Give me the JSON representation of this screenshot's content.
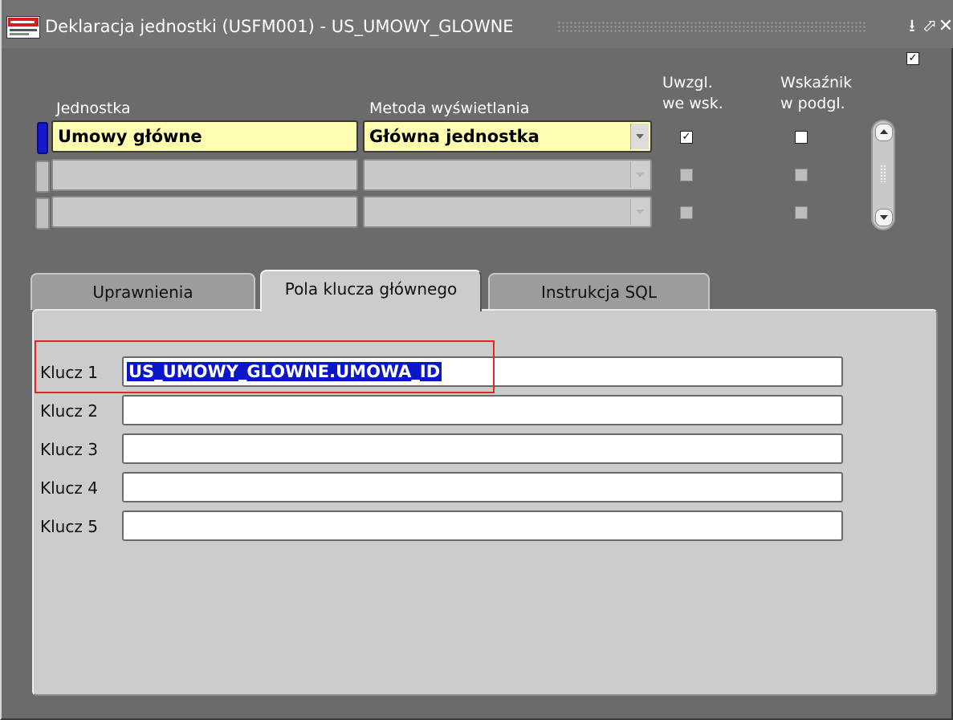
{
  "window": {
    "title": "Deklaracja jednostki (USFM001) - US_UMOWY_GLOWNE",
    "buttons": {
      "minimize": "⭳",
      "maximize": "⬀",
      "close": "✕"
    }
  },
  "columns": {
    "jednostka": "Jednostka",
    "metoda": "Metoda wyświetlania",
    "uwzgl_line1": "Uwzgl.",
    "uwzgl_line2": "we wsk.",
    "wskaznik_line1": "Wskaźnik",
    "wskaznik_line2": "w podgl."
  },
  "rows": [
    {
      "jednostka": "Umowy główne",
      "metoda": "Główna jednostka",
      "uwzgl": true,
      "wskaznik": false,
      "active": true
    },
    {
      "jednostka": "",
      "metoda": "",
      "uwzgl": false,
      "wskaznik": false,
      "active": false
    },
    {
      "jednostka": "",
      "metoda": "",
      "uwzgl": false,
      "wskaznik": false,
      "active": false
    }
  ],
  "tabs": [
    {
      "label": "Uprawnienia",
      "active": false
    },
    {
      "label": "Pola klucza głównego",
      "active": true
    },
    {
      "label": "Instrukcja SQL",
      "active": false
    }
  ],
  "keys": [
    {
      "label": "Klucz 1",
      "value": "US_UMOWY_GLOWNE.UMOWA_ID"
    },
    {
      "label": "Klucz 2",
      "value": ""
    },
    {
      "label": "Klucz 3",
      "value": ""
    },
    {
      "label": "Klucz 4",
      "value": ""
    },
    {
      "label": "Klucz 5",
      "value": ""
    }
  ],
  "corner_checkbox": "✓",
  "colors": {
    "selection": "#0a16c8",
    "required_field": "#fffdb0",
    "highlight": "#e0262a"
  }
}
